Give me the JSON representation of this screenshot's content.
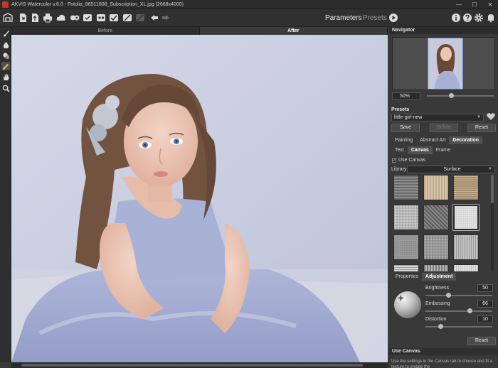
{
  "window": {
    "title": "AKVIS Watercolor v.6.0 - Fotolia_86511808_Subscription_XL.jpg (2668x4000)",
    "minimize": "—",
    "maximize": "☐",
    "close": "✕"
  },
  "toolbar": {
    "parameters_label": "Parameters",
    "presets_label": "Presets",
    "icons": [
      "home-icon",
      "open-icon",
      "save-icon",
      "print-icon",
      "share-icon",
      "batch-icon",
      "before-after-icon",
      "plugin-icon",
      "apply-icon",
      "settings-icon",
      "undo-icon",
      "redo-icon",
      "info-icon",
      "help-icon",
      "gear-icon",
      "play-icon"
    ]
  },
  "view_tabs": {
    "before": "Before",
    "after": "After"
  },
  "navigator": {
    "header": "Navigator",
    "zoom": "50%"
  },
  "presets": {
    "header": "Presets",
    "selected": "little-girl-new",
    "save": "Save",
    "delete": "Delete",
    "reset": "Reset"
  },
  "main_tabs": [
    "Painting",
    "Abstract Art",
    "Decoration"
  ],
  "sub_tabs": [
    "Text",
    "Canvas",
    "Frame"
  ],
  "use_canvas": {
    "label": "Use Canvas",
    "checked": "✓"
  },
  "library": {
    "label": "Library",
    "value": "Surface"
  },
  "property_tabs": [
    "Properties",
    "Adjustment"
  ],
  "adjustment": {
    "brightness": {
      "label": "Brightness",
      "value": "50"
    },
    "embossing": {
      "label": "Embossing",
      "value": "66"
    },
    "distortion": {
      "label": "Distortion",
      "value": "10"
    },
    "reset": "Reset"
  },
  "hint": {
    "title": "Use Canvas",
    "text": "Use the settings in the Canvas tab to choose and fit a texture to imitate the"
  }
}
